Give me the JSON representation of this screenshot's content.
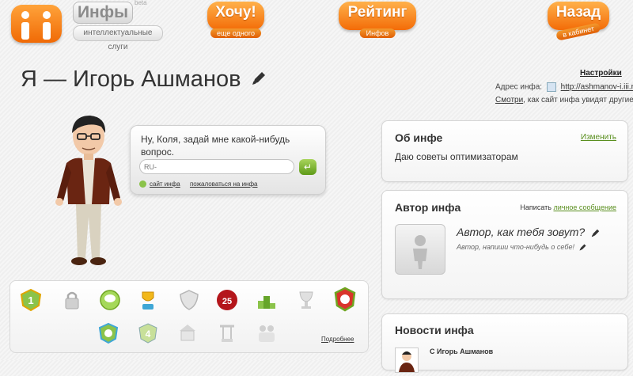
{
  "nav": {
    "brand_name": "Инфы",
    "brand_sub": "интеллектуальные слуги",
    "brand_beta": "beta",
    "want_label": "Хочу!",
    "want_sub": "еще одного",
    "rating_label": "Рейтинг",
    "rating_sub": "Инфов",
    "back_label": "Назад",
    "back_sub": "в кабинет",
    "accent_color": "#f36b07"
  },
  "header": {
    "title": "Я — Игорь Ашманов",
    "settings_label": "Настройки",
    "address_label": "Адрес инфа:",
    "address_url": "http://ashmanov-i.iii.ru/",
    "look_link": "Смотри",
    "look_text": ", как сайт инфа увидят другие"
  },
  "chat": {
    "question": "Ну, Коля, задай мне какой-нибудь вопрос.",
    "input_value": "RU-",
    "send_icon": "enter-arrow-icon",
    "link_site": "сайт инфа",
    "link_complain": "пожаловаться на инфа"
  },
  "awards": {
    "more_label": "Подробнее",
    "badge_top25_text": "25",
    "items": [
      "badge-1",
      "badge-lock",
      "badge-bubble",
      "badge-cup",
      "badge-shield",
      "badge-top25",
      "badge-podium",
      "badge-goblet",
      "badge-wreath",
      "badge-9",
      "badge-4",
      "badge-carousel",
      "badge-swing",
      "badge-people"
    ]
  },
  "about": {
    "title": "Об инфе",
    "edit_label": "Изменить",
    "description": "Даю советы оптимизаторам"
  },
  "author": {
    "title": "Автор инфа",
    "write_label": "Написать",
    "write_link": "личное сообщение",
    "question": "Автор, как тебя зовут?",
    "hint": "Автор, напиши что-нибудь о себе!"
  },
  "news": {
    "title": "Новости инфа",
    "first_item": "С Игорь Ашманов"
  }
}
